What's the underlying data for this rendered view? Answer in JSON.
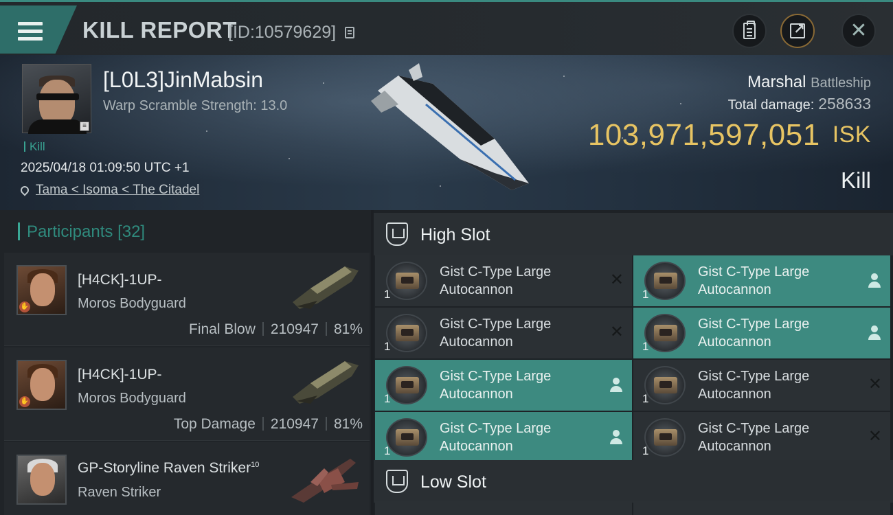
{
  "header": {
    "title": "KILL REPORT",
    "report_id": "[ID:10579629]",
    "icons": [
      "menu-icon",
      "copy-icon",
      "clipboard-icon",
      "share-icon",
      "close-icon"
    ]
  },
  "victim": {
    "pilot": "[L0L3]JinMabsin",
    "warp_scramble": "Warp Scramble Strength: 13.0",
    "tag": "Kill",
    "timestamp": "2025/04/18 01:09:50 UTC +1",
    "location": "Tama < Isoma < The Citadel",
    "ship": "Marshal",
    "ship_class": "Battleship",
    "total_damage_label": "Total damage:",
    "total_damage": "258633",
    "isk_value": "103,971,597,051",
    "isk_unit": "ISK",
    "result": "Kill"
  },
  "participants": {
    "label": "Participants",
    "count": "[32]",
    "items": [
      {
        "name": "[H4CK]-1UP-",
        "ship": "Moros Bodyguard",
        "role": "Final Blow",
        "damage": "210947",
        "percent": "81%"
      },
      {
        "name": "[H4CK]-1UP-",
        "ship": "Moros Bodyguard",
        "role": "Top Damage",
        "damage": "210947",
        "percent": "81%"
      },
      {
        "name": "GP-Storyline Raven Striker",
        "level": "10",
        "ship": "Raven Striker"
      }
    ]
  },
  "slots": {
    "high_label": "High Slot",
    "low_label": "Low Slot",
    "high_modules": [
      {
        "line1": "Gist C-Type Large",
        "line2": "Autocannon",
        "qty": "1",
        "status": "destroyed"
      },
      {
        "line1": "Gist C-Type Large",
        "line2": "Autocannon",
        "qty": "1",
        "status": "dropped"
      },
      {
        "line1": "Gist C-Type Large",
        "line2": "Autocannon",
        "qty": "1",
        "status": "destroyed"
      },
      {
        "line1": "Gist C-Type Large",
        "line2": "Autocannon",
        "qty": "1",
        "status": "dropped"
      },
      {
        "line1": "Gist C-Type Large",
        "line2": "Autocannon",
        "qty": "1",
        "status": "dropped"
      },
      {
        "line1": "Gist C-Type Large",
        "line2": "Autocannon",
        "qty": "1",
        "status": "destroyed"
      },
      {
        "line1": "Gist C-Type Large",
        "line2": "Autocannon",
        "qty": "1",
        "status": "dropped"
      },
      {
        "line1": "Gist C-Type Large",
        "line2": "Autocannon",
        "qty": "1",
        "status": "destroyed"
      }
    ]
  },
  "colors": {
    "accent": "#3d8a80",
    "isk": "#e7c463",
    "kill_tag": "#39a392"
  }
}
